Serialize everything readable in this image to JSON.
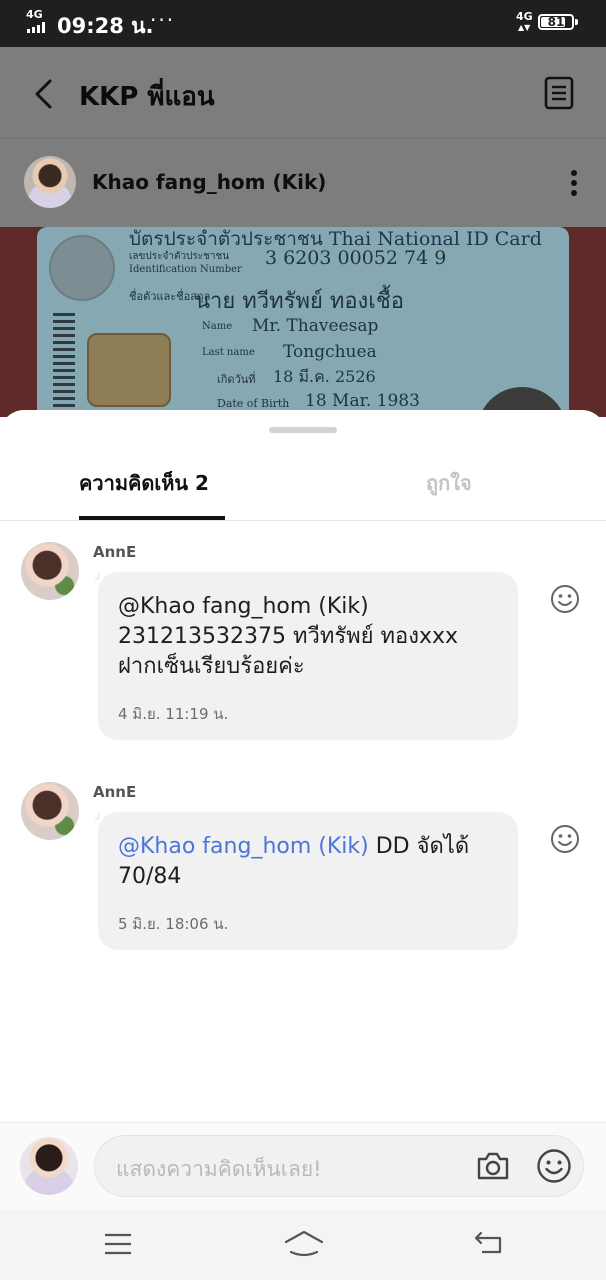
{
  "status_bar": {
    "network_left": "4G",
    "time": "09:28 น.",
    "dots": "···",
    "network_right": "4G",
    "battery_level": "81",
    "battery_fraction": 0.81
  },
  "header": {
    "title": "KKP พี่แอน",
    "back_icon": "chevron-left-icon",
    "note_icon": "note-icon"
  },
  "post": {
    "author": "Khao fang_hom (Kik)",
    "more_icon": "more-vertical-icon",
    "image_text": {
      "line1": "บัตรประจำตัวประชาชน Thai National ID Card",
      "line2": "เลขประจำตัวประชาชน",
      "id_number": "3 6203 00052 74 9",
      "line4": "Identification Number",
      "line5": "ชื่อตัวและชื่อสกุล",
      "thai_name": "นาย ทวีทรัพย์  ทองเชื้อ",
      "name_label": "Name",
      "name_value": "Mr. Thaveesap",
      "lastname_label": "Last name",
      "lastname_value": "Tongchuea",
      "birth_th_label": "เกิดวันที่",
      "birth_th_value": "18 มี.ค. 2526",
      "dob_label": "Date of Birth",
      "dob_value": "18 Mar. 1983"
    }
  },
  "sheet": {
    "tabs": [
      {
        "label": "ความคิดเห็น 2",
        "active": true
      },
      {
        "label": "ถูกใจ",
        "active": false
      }
    ],
    "comments": [
      {
        "author": "AnnE",
        "mention": "@Khao fang_hom (Kik)",
        "line1": "231213532375 ทวีทรัพย์ ทองxxx",
        "line2": "ฝากเซ็นเรียบร้อยค่ะ",
        "time": "4 มิ.ย. 11:19 น."
      },
      {
        "author": "AnnE",
        "mention": "@Khao fang_hom (Kik)",
        "line1": " DD จัดได้",
        "line2": "70/84",
        "time": "5 มิ.ย. 18:06 น."
      }
    ]
  },
  "input": {
    "placeholder": "แสดงความคิดเห็นเลย!",
    "camera_icon": "camera-icon",
    "emoji_icon": "emoji-icon"
  },
  "nav": {
    "menu_icon": "menu-icon",
    "home_icon": "home-icon",
    "back_icon": "back-icon"
  },
  "colors": {
    "mention": "#4d74d8",
    "status_bar": "#1f1f1f",
    "dim_overlay": "#7d7d7d",
    "bubble": "#f1f1f1"
  }
}
